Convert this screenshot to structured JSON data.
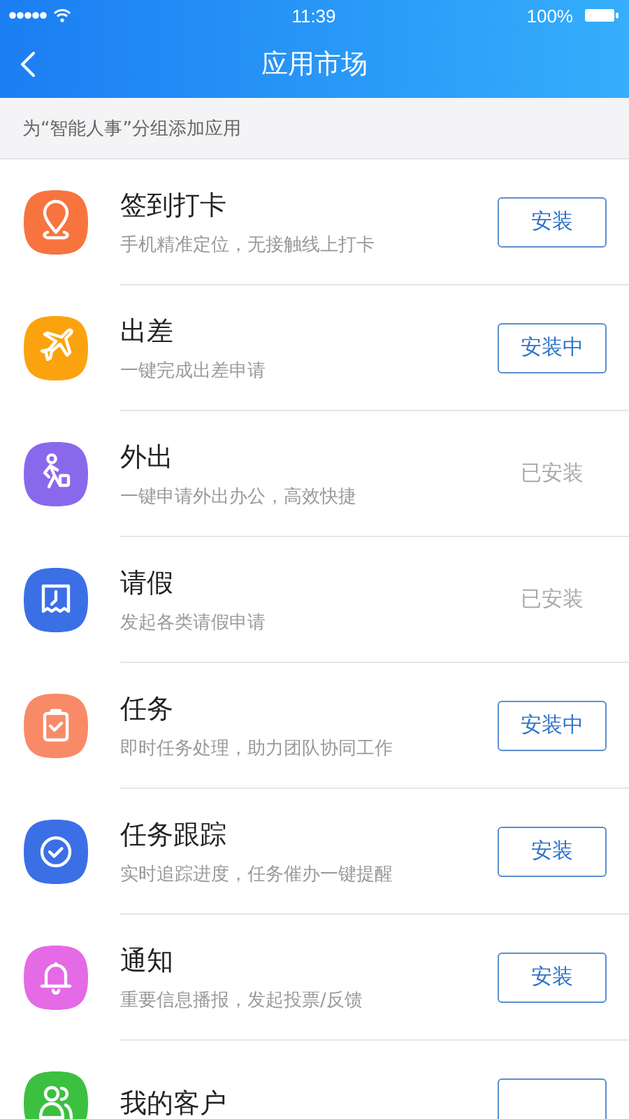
{
  "status_bar": {
    "time": "11:39",
    "battery": "100%"
  },
  "nav": {
    "title": "应用市场"
  },
  "section": {
    "label": "为“智能人事”分组添加应用"
  },
  "apps": [
    {
      "title": "签到打卡",
      "description": "手机精准定位，无接触线上打卡",
      "color": "#f7743f",
      "action": {
        "kind": "button",
        "label": "安装"
      }
    },
    {
      "title": "出差",
      "description": "一键完成出差申请",
      "color": "#fba30e",
      "action": {
        "kind": "button",
        "label": "安装中"
      }
    },
    {
      "title": "外出",
      "description": "一键申请外出办公，高效快捷",
      "color": "#8a68ec",
      "action": {
        "kind": "done",
        "label": "已安装"
      }
    },
    {
      "title": "请假",
      "description": "发起各类请假申请",
      "color": "#3b6fe6",
      "action": {
        "kind": "done",
        "label": "已安装"
      }
    },
    {
      "title": "任务",
      "description": "即时任务处理，助力团队协同工作",
      "color": "#f98a68",
      "action": {
        "kind": "button",
        "label": "安装中"
      }
    },
    {
      "title": "任务跟踪",
      "description": "实时追踪进度，任务催办一键提醒",
      "color": "#3b6fe6",
      "action": {
        "kind": "button",
        "label": "安装"
      }
    },
    {
      "title": "通知",
      "description": "重要信息播报，发起投票/反馈",
      "color": "#e46ae6",
      "action": {
        "kind": "button",
        "label": "安装"
      }
    },
    {
      "title": "我的客户",
      "color": "#3cc040",
      "action": {
        "kind": "button"
      }
    }
  ]
}
